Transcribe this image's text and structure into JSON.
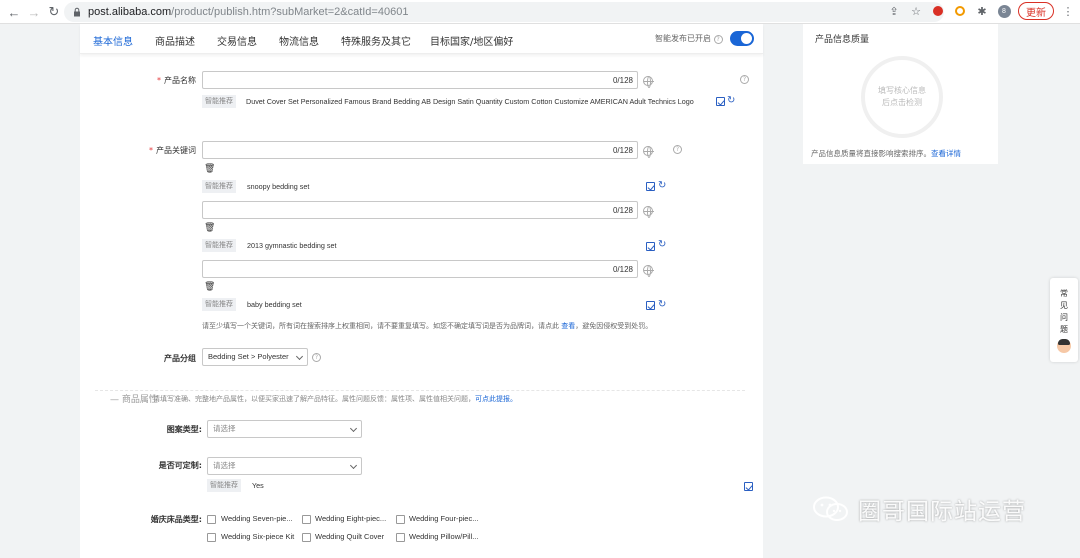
{
  "browser": {
    "url_host": "post.alibaba.com",
    "url_path": "/product/publish.htm?subMarket=2&catId=40601",
    "profile_initial": "8",
    "update_label": "更新"
  },
  "tabs": [
    "基本信息",
    "商品描述",
    "交易信息",
    "物流信息",
    "特殊服务及其它",
    "目标国家/地区偏好"
  ],
  "smart_publish": {
    "label": "智能发布已开启",
    "enabled": true
  },
  "product_name": {
    "label": "产品名称",
    "counter": "0/128",
    "tag": "智能推荐",
    "suggestion": "Duvet Cover Set Personalized Famous Brand Bedding AB Design Satin Quantity Custom Cotton Customize AMERICAN Adult Technics Logo"
  },
  "keywords": {
    "label": "产品关键词",
    "counter": "0/128",
    "tag": "智能推荐",
    "trash_glyph": "🗑",
    "suggestions": [
      "snoopy bedding set",
      "2013 gymnastic bedding set",
      "baby bedding set"
    ],
    "hint_prefix": "请至少填写一个关键词，所有词在搜索排序上权重相同，请不要重复填写。如您不确定填写词是否为品牌词，请点此",
    "hint_link": "查看",
    "hint_suffix": "，避免因侵权受到处罚。"
  },
  "product_group": {
    "label": "产品分组",
    "value": "Bedding Set > Polyester"
  },
  "attributes": {
    "title": "商品属性",
    "desc": "请填写准确、完整地产品属性，以便买家迅速了解产品特征。属性问题反馈：属性项、属性值相关问题，",
    "desc_link": "可点此提报。",
    "pattern_type": {
      "label": "图案类型:",
      "placeholder": "请选择"
    },
    "customizable": {
      "label": "是否可定制:",
      "placeholder": "请选择",
      "tag": "智能推荐",
      "value": "Yes"
    },
    "wedding": {
      "label": "婚庆床品类型:",
      "options": [
        "Wedding Seven-pie...",
        "Wedding Eight-piec...",
        "Wedding Four-piec...",
        "Wedding Six-piece Kit",
        "Wedding Quilt Cover",
        "Wedding Pillow/Pill..."
      ]
    }
  },
  "quality_panel": {
    "title": "产品信息质量",
    "circle_text": "填写核心信息后点击检测",
    "note": "产品信息质量将直接影响搜索排序。",
    "note_link": "查看详情"
  },
  "faq": {
    "chars": [
      "常",
      "见",
      "问",
      "题"
    ]
  },
  "watermark": {
    "text": "圈哥国际站运营"
  }
}
